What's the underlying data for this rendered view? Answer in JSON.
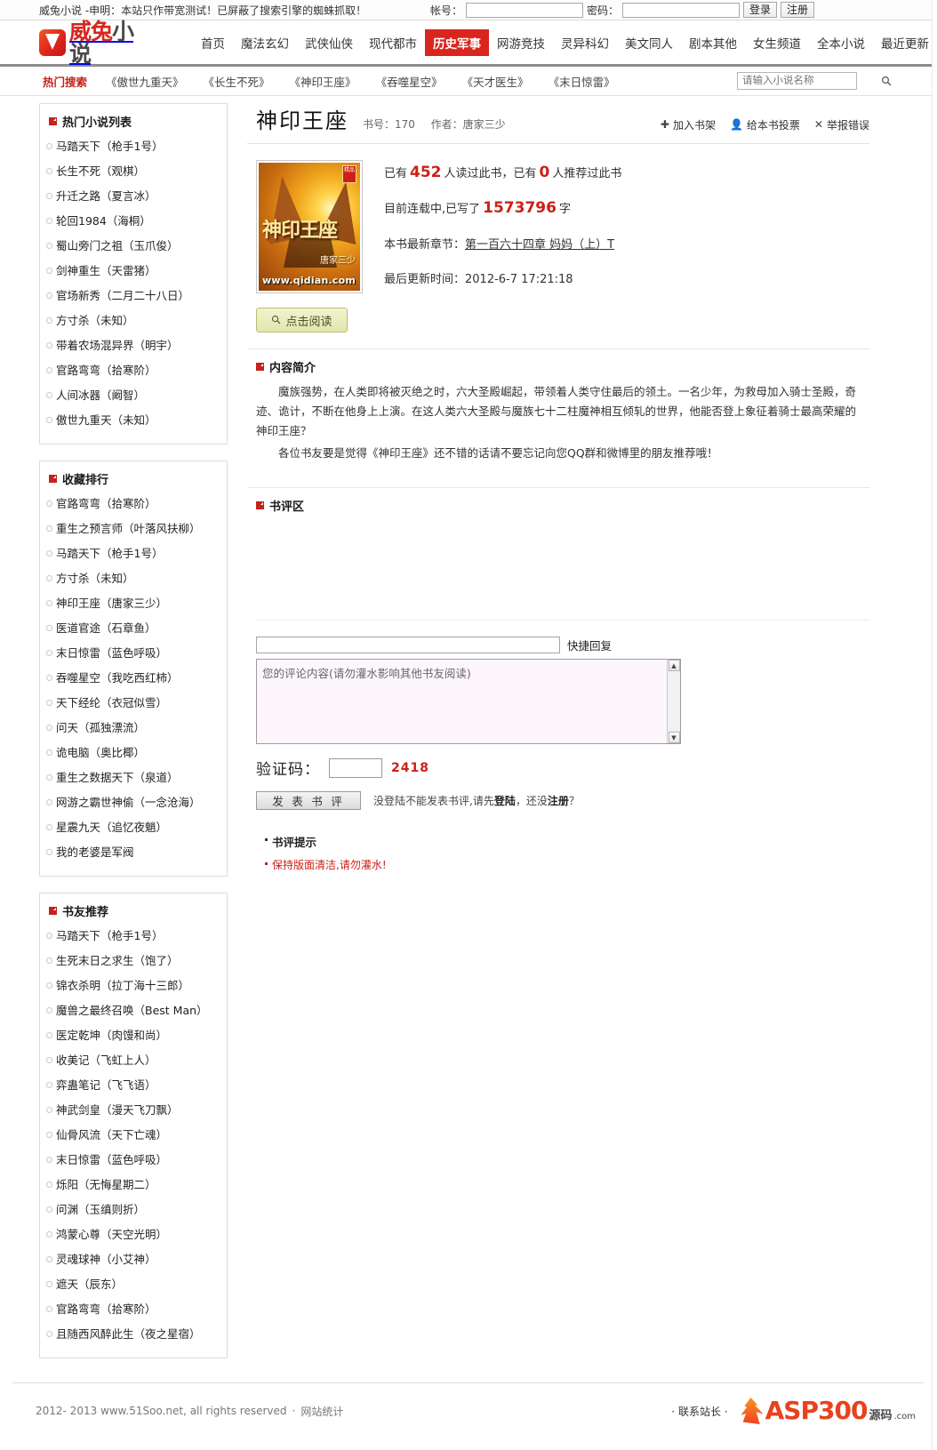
{
  "topbar": {
    "notice": "威兔小说 -申明：本站只作带宽测试！已屏蔽了搜索引擎的蜘蛛抓取！",
    "account_label": "帐号：",
    "password_label": "密码：",
    "account_value": "",
    "password_value": "",
    "login_button": "登录",
    "register_button": "注册"
  },
  "header": {
    "logo_red": "威兔",
    "logo_gray": "小说",
    "nav": [
      {
        "label": "首页",
        "active": false
      },
      {
        "label": "魔法玄幻",
        "active": false
      },
      {
        "label": "武侠仙侠",
        "active": false
      },
      {
        "label": "现代都市",
        "active": false
      },
      {
        "label": "历史军事",
        "active": true
      },
      {
        "label": "网游竞技",
        "active": false
      },
      {
        "label": "灵异科幻",
        "active": false
      },
      {
        "label": "美文同人",
        "active": false
      },
      {
        "label": "剧本其他",
        "active": false
      },
      {
        "label": "女生频道",
        "active": false
      },
      {
        "label": "全本小说",
        "active": false
      },
      {
        "label": "最近更新",
        "active": false
      }
    ]
  },
  "hotbar": {
    "title": "热门搜索",
    "links": [
      "《傲世九重天》",
      "《长生不死》",
      "《神印王座》",
      "《吞噬星空》",
      "《天才医生》",
      "《末日惊雷》"
    ],
    "search_placeholder": "请输入小说名称",
    "search_value": "",
    "search_icon": "search-icon"
  },
  "sidebar": {
    "panels": [
      {
        "title": "热门小说列表",
        "items": [
          "马踏天下（枪手1号）",
          "长生不死（观棋）",
          "升迁之路（夏言冰）",
          "轮回1984（海桐）",
          "蜀山旁门之祖（玉爪俊）",
          "剑神重生（天雷猪）",
          "官场新秀（二月二十八日）",
          "方寸杀（未知）",
          "带着农场混异界（明宇）",
          "官路弯弯（拾寒阶）",
          "人间冰器（阚智）",
          "傲世九重天（未知）"
        ]
      },
      {
        "title": "收藏排行",
        "items": [
          "官路弯弯（拾寒阶）",
          "重生之预言师（叶落风扶柳）",
          "马踏天下（枪手1号）",
          "方寸杀（未知）",
          "神印王座（唐家三少）",
          "医道官途（石章鱼）",
          "末日惊雷（蓝色呼吸）",
          "吞噬星空（我吃西红柿）",
          "天下经纶（衣冠似雪）",
          "问天（孤独漂流）",
          "诡电脑（奥比椰）",
          "重生之数据天下（泉道）",
          "网游之霸世神偷（一念沧海）",
          "星震九天（追忆夜魈）",
          "我的老婆是军阀"
        ]
      },
      {
        "title": "书友推荐",
        "items": [
          "马踏天下（枪手1号）",
          "生死末日之求生（饱了）",
          "锦衣杀明（拉丁海十三郎）",
          "魔兽之最终召唤（Best Man）",
          "医定乾坤（肉馒和尚）",
          "收美记（飞虹上人）",
          "弈蛊笔记（飞飞语）",
          "神武剑皇（漫天飞刀飘）",
          "仙骨风流（天下亡魂）",
          "末日惊雷（蓝色呼吸）",
          "烁阳（无悔星期二）",
          "问渊（玉缜则折）",
          "鸿蒙心尊（天空光明）",
          "灵魂球神（小艾神）",
          "遮天（辰东）",
          "官路弯弯（拾寒阶）",
          "且随西风醉此生（夜之星宿）"
        ]
      }
    ]
  },
  "book": {
    "title": "神印王座",
    "book_no_label": "书号：",
    "book_no": "170",
    "author_label": "作者：",
    "author": "唐家三少",
    "actions": [
      {
        "label": "加入书架",
        "icon": "plus-icon"
      },
      {
        "label": "给本书投票",
        "icon": "vote-person-icon"
      },
      {
        "label": "举报错误",
        "icon": "report-error-icon"
      }
    ],
    "cover": {
      "title": "神印王座",
      "author": "唐家三少",
      "url": "www.qidian.com",
      "badge": "精品"
    },
    "read_button": "点击阅读",
    "read_button_icon": "magnifier-icon",
    "stats_prefix": "已有",
    "read_count": "452",
    "stats_mid": "人读过此书，已有",
    "recommend_count": "0",
    "stats_suffix": "人推荐过此书",
    "status_prefix": "目前连载中,已写了",
    "word_count": "1573796",
    "status_suffix": "字",
    "latest_label": "本书最新章节：",
    "latest_chapter": "第一百六十四章 妈妈（上）T",
    "updated_label": "最后更新时间：",
    "updated_time": "2012-6-7 17:21:18"
  },
  "intro": {
    "heading": "内容简介",
    "paragraphs": [
      "魔族强势，在人类即将被灭绝之时，六大圣殿崛起，带领着人类守住最后的领土。一名少年，为救母加入骑士圣殿，奇迹、诡计，不断在他身上上演。在这人类六大圣殿与魔族七十二柱魔神相互倾轧的世界，他能否登上象征着骑士最高荣耀的神印王座？",
      "各位书友要是觉得《神印王座》还不错的话请不要忘记向您QQ群和微博里的朋友推荐哦！"
    ]
  },
  "review": {
    "heading": "书评区",
    "quick_reply_value": "",
    "quick_reply_label": "快捷回复",
    "comment_placeholder": "您的评论内容(请勿灌水影响其他书友阅读)",
    "comment_value": "",
    "captcha_label": "验证码：",
    "captcha_value": "",
    "captcha_code": "2418",
    "submit_label": "发 表 书 评",
    "note_before": "没登陆不能发表书评,请先",
    "note_login": "登陆",
    "note_middle": "，还没",
    "note_register": "注册",
    "note_after": "？",
    "tips_title": "书评提示",
    "tips_items": [
      "保持版面清洁,请勿灌水!"
    ]
  },
  "footer": {
    "copyright": "2012- 2013 www.51Soo.net, all rights reserved",
    "separator": "·",
    "stats_link": "网站统计",
    "contact": "联系站长",
    "brand_text": "ASP300",
    "brand_cn": "源码",
    "brand_com": ".com"
  }
}
